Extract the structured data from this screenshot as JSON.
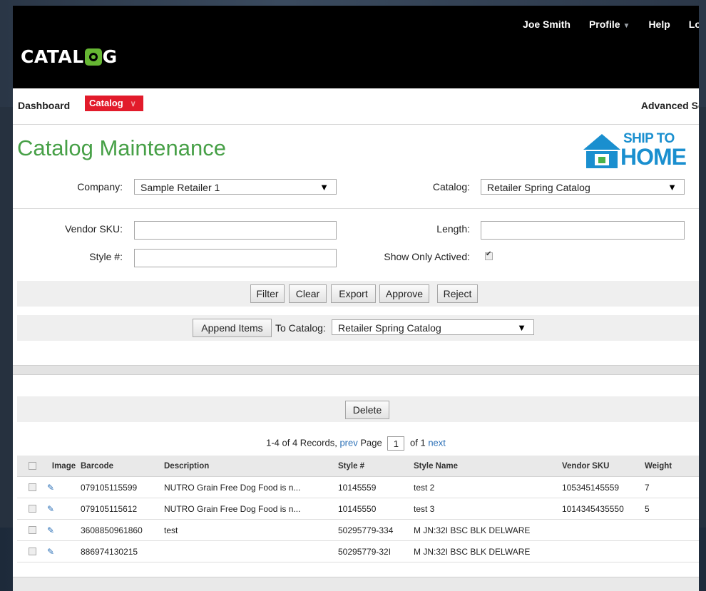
{
  "header": {
    "brand": "CATAL G",
    "brand_left": "CATAL",
    "brand_right": "G",
    "user_name": "Joe Smith",
    "profile_label": "Profile",
    "help_label": "Help",
    "logout_label": "Logo"
  },
  "nav": {
    "dashboard_label": "Dashboard",
    "catalog_label": "Catalog",
    "advanced_search_label": "Advanced Sear"
  },
  "page": {
    "title": "Catalog Maintenance",
    "logo_line1": "SHIP TO",
    "logo_line2": "HOME"
  },
  "filters": {
    "company_label": "Company:",
    "company_value": "Sample Retailer 1",
    "catalog_label": "Catalog:",
    "catalog_value": "Retailer Spring Catalog",
    "vendor_sku_label": "Vendor SKU:",
    "vendor_sku_value": "",
    "length_label": "Length:",
    "length_value": "",
    "style_label": "Style #:",
    "style_value": "",
    "show_only_label": "Show Only Actived:",
    "show_only_checked": true
  },
  "actions": {
    "filter": "Filter",
    "clear": "Clear",
    "export": "Export",
    "approve": "Approve",
    "reject": "Reject",
    "append_items": "Append Items",
    "to_catalog_label": "To Catalog:",
    "to_catalog_value": "Retailer Spring Catalog",
    "delete": "Delete"
  },
  "pager": {
    "records": "1-4 of 4 Records,",
    "prev": "prev",
    "page_label": "Page",
    "page_value": "1",
    "of_label": "of 1",
    "next": "next"
  },
  "table": {
    "columns": [
      "",
      "Image",
      "Barcode",
      "Description",
      "Style #",
      "Style Name",
      "Vendor SKU",
      "Weight"
    ],
    "rows": [
      {
        "barcode": "079105115599",
        "description": "NUTRO Grain Free Dog Food is n...",
        "style": "10145559",
        "style_name": "test 2",
        "vendor_sku": "105345145559",
        "weight": "7"
      },
      {
        "barcode": "079105115612",
        "description": "NUTRO Grain Free Dog Food is n...",
        "style": "10145550",
        "style_name": "test 3",
        "vendor_sku": "1014345435550",
        "weight": "5"
      },
      {
        "barcode": "3608850961860",
        "description": "test",
        "style": "50295779-334",
        "style_name": "M JN:32I BSC BLK DELWARE",
        "vendor_sku": "",
        "weight": ""
      },
      {
        "barcode": "886974130215",
        "description": "",
        "style": "50295779-32I",
        "style_name": "M JN:32I BSC BLK DELWARE",
        "vendor_sku": "",
        "weight": ""
      }
    ]
  },
  "colors": {
    "title_green": "#47a047",
    "catalog_red": "#e21b2b",
    "link_blue": "#2a6fb6",
    "ship_blue": "#1a8fcf",
    "logo_green": "#66b633"
  },
  "icons": {
    "profile_caret": "caret-down-icon",
    "catalog_caret": "chevron-down-icon",
    "edit": "pencil-icon",
    "camera": "camera-logo-icon",
    "house": "house-icon"
  }
}
